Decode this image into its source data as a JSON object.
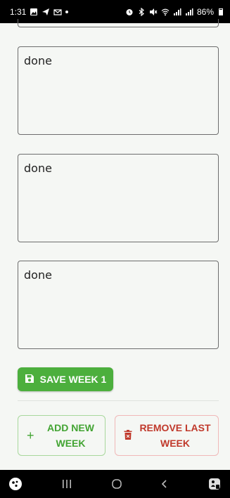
{
  "status_bar": {
    "time": "1:31",
    "battery": "86%",
    "left_icons": [
      "image-icon",
      "send-icon",
      "mail-icon",
      "dot"
    ],
    "right_icons": [
      "alarm-icon",
      "bluetooth-icon",
      "mute-icon",
      "wifi-icon",
      "signal-icon",
      "signal-icon",
      "battery-icon"
    ]
  },
  "notes": [
    {
      "value": "done"
    },
    {
      "value": "done"
    },
    {
      "value": "done"
    }
  ],
  "actions": {
    "save_label": "SAVE WEEK 1",
    "add_line1": "ADD NEW",
    "add_line2": "WEEK",
    "remove_line1": "REMOVE LAST",
    "remove_line2": "WEEK"
  },
  "colors": {
    "background": "#f5f7f4",
    "save_green": "#4caf3d",
    "add_green": "#43a433",
    "remove_red": "#c0392b"
  },
  "nav_bar": {
    "items": [
      "assistant-icon",
      "recent-apps-icon",
      "home-icon",
      "back-icon",
      "accessibility-icon"
    ]
  }
}
